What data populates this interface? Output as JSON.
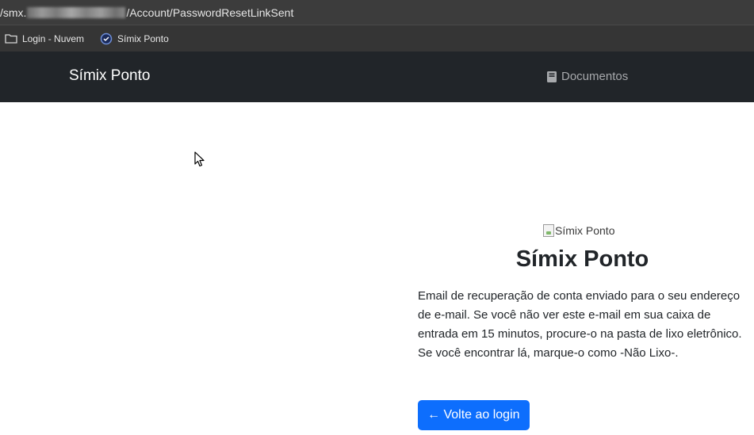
{
  "browser": {
    "url_prefix": "/smx.",
    "url_suffix": "/Account/PasswordResetLinkSent",
    "bookmarks": [
      {
        "label": "Login - Nuvem",
        "icon": "folder-icon"
      },
      {
        "label": "Símix Ponto",
        "icon": "clock-check-icon"
      }
    ]
  },
  "navbar": {
    "brand": "Símix Ponto",
    "docs_label": "Documentos",
    "docs_icon": "book-icon"
  },
  "main": {
    "logo_alt": "Símix Ponto",
    "title": "Símix Ponto",
    "message": "Email de recuperação de conta enviado para o seu endereço de e-mail. Se você não ver este e-mail em sua caixa de entrada em 15 minutos, procure-o na pasta de lixo eletrônico. Se você encontrar lá, marque-o como -Não Lixo-.",
    "back_button": "← Volte ao login"
  },
  "colors": {
    "navbar_bg": "#212529",
    "primary_button": "#0d6efd",
    "chrome_bg": "#3c3c3c"
  }
}
